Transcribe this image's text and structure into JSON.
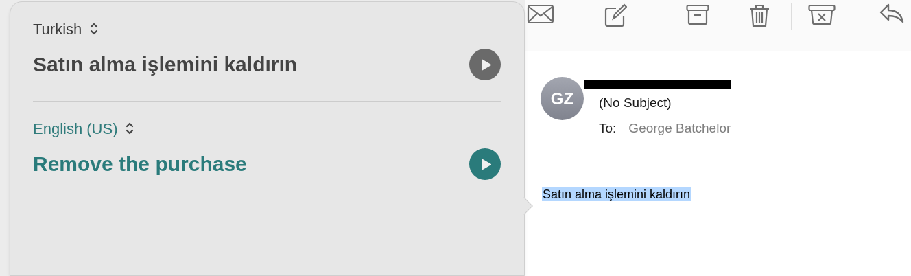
{
  "translation_popover": {
    "languages": [
      {
        "kind": "source",
        "language": "Turkish",
        "text": "Satın alma işlemini kaldırın"
      },
      {
        "kind": "target",
        "language": "English (US)",
        "text": "Remove the purchase"
      }
    ]
  },
  "message": {
    "avatar": "GZ",
    "sender_redacted": true,
    "subject": "(No Subject)",
    "to_label": "To:",
    "to": "George Batchelor",
    "body": {
      "text": "Satın alma işlemini kaldırın",
      "selected": true
    }
  }
}
